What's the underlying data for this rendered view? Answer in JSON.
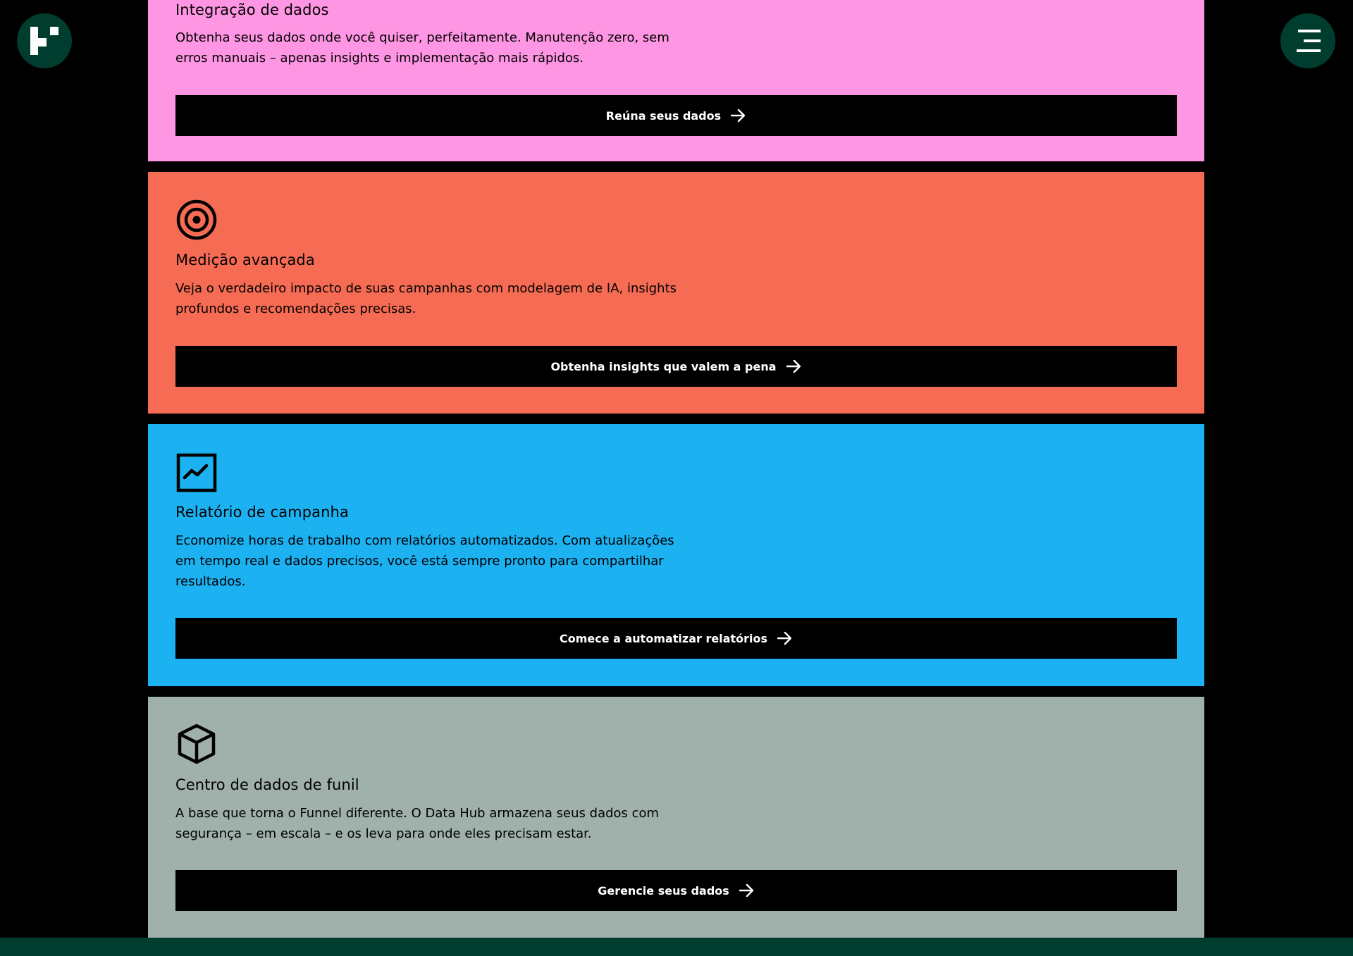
{
  "colors": {
    "background": "#000000",
    "brand_green": "#003d2e",
    "card_pink": "#ff96e4",
    "card_orange": "#f66b53",
    "card_blue": "#1cb1f1",
    "card_gray": "#a0b1ab",
    "button_bg": "#000000",
    "button_text": "#ffffff"
  },
  "header": {
    "logo_icon": "funnel-logo-icon",
    "menu_icon": "hamburger-menu-icon"
  },
  "cards": [
    {
      "icon": "data-integration-icon",
      "title": "Integração de dados",
      "description": "Obtenha seus dados onde você quiser, perfeitamente. Manutenção zero, sem erros manuais – apenas insights e implementação mais rápidos.",
      "button_label": "Reúna seus dados"
    },
    {
      "icon": "target-icon",
      "title": "Medição avançada",
      "description": "Veja o verdadeiro impacto de suas campanhas com modelagem de IA, insights profundos e recomendações precisas.",
      "button_label": "Obtenha insights que valem a pena"
    },
    {
      "icon": "chart-trend-icon",
      "title": "Relatório de campanha",
      "description": "Economize horas de trabalho com relatórios automatizados. Com atualizações em tempo real e dados precisos, você está sempre pronto para compartilhar resultados.",
      "button_label": "Comece a automatizar relatórios"
    },
    {
      "icon": "cube-icon",
      "title": "Centro de dados de funil",
      "description": "A base que torna o Funnel diferente. O Data Hub armazena seus dados com segurança – em escala – e os leva para onde eles precisam estar.",
      "button_label": "Gerencie seus dados"
    }
  ]
}
